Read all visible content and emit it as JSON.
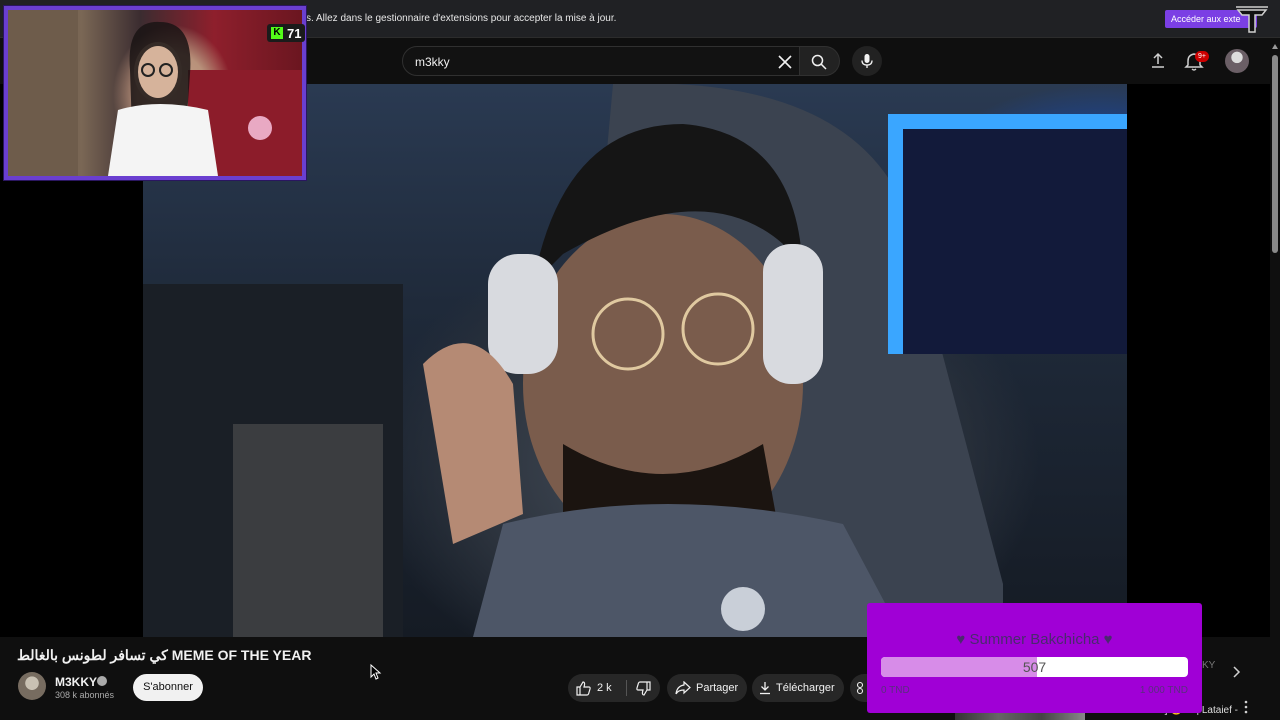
{
  "extension_bar": {
    "message": "s. Allez dans le gestionnaire d'extensions pour accepter la mise à jour.",
    "action_label": "Accéder aux exte"
  },
  "masthead": {
    "search_value": "m3kky",
    "notifications_badge": "9+"
  },
  "webcam": {
    "platform_icon": "K",
    "viewer_count": "71"
  },
  "video": {
    "title": "كي تسافر لطونس بالغالط MEME OF THE YEAR"
  },
  "channel": {
    "name": "M3KKY",
    "subscribers": "308 k abonnés",
    "subscribe_label": "S'abonner"
  },
  "actions": {
    "like_count": "2 k",
    "share_label": "Partager",
    "download_label": "Télécharger"
  },
  "donation_goal": {
    "title": "♥ Summer Bakchicha ♥",
    "current": "507",
    "min_label": "0 TND",
    "max_label": "1 000 TND",
    "progress_fraction": 0.507
  },
  "sidebar_peek": {
    "chip_text": "KY",
    "item_text": "N ] 😍 ... | Lataief -"
  },
  "colors": {
    "accent_purple": "#7b3fe4",
    "goal_bg": "#a000d6",
    "goal_fill": "#d78ce8",
    "kick_green": "#53fc18",
    "notif_red": "#cc0000"
  }
}
